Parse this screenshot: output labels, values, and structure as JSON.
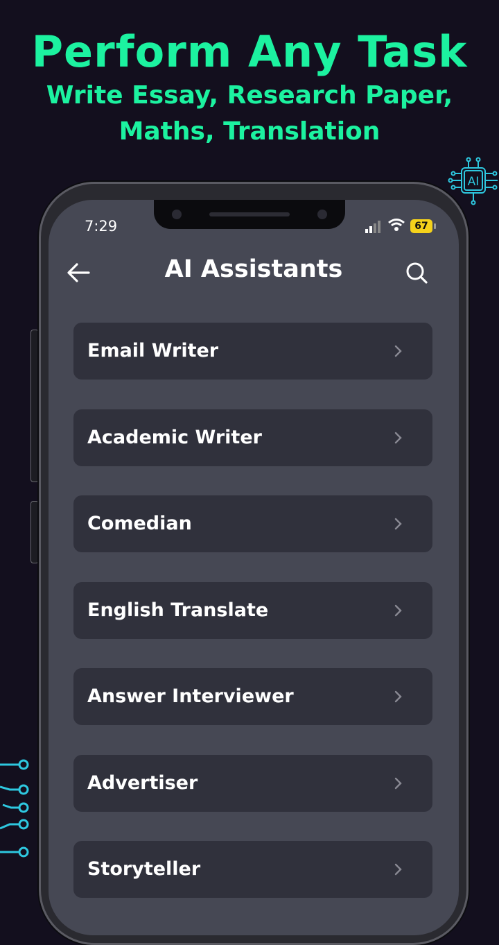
{
  "promo": {
    "title": "Perform Any Task",
    "subtitle_line1": "Write Essay, Research Paper,",
    "subtitle_line2": "Maths, Translation",
    "accent_color": "#1cf2a0"
  },
  "ai_badge": {
    "label": "AI",
    "icon": "ai-chip-icon"
  },
  "status_bar": {
    "time": "7:29",
    "battery": "67"
  },
  "header": {
    "title": "AI Assistants",
    "back_icon": "arrow-left-icon",
    "search_icon": "search-icon"
  },
  "assistants": [
    {
      "label": "Email Writer"
    },
    {
      "label": "Academic Writer"
    },
    {
      "label": "Comedian"
    },
    {
      "label": "English Translate"
    },
    {
      "label": "Answer Interviewer"
    },
    {
      "label": "Advertiser"
    },
    {
      "label": "Storyteller"
    }
  ]
}
